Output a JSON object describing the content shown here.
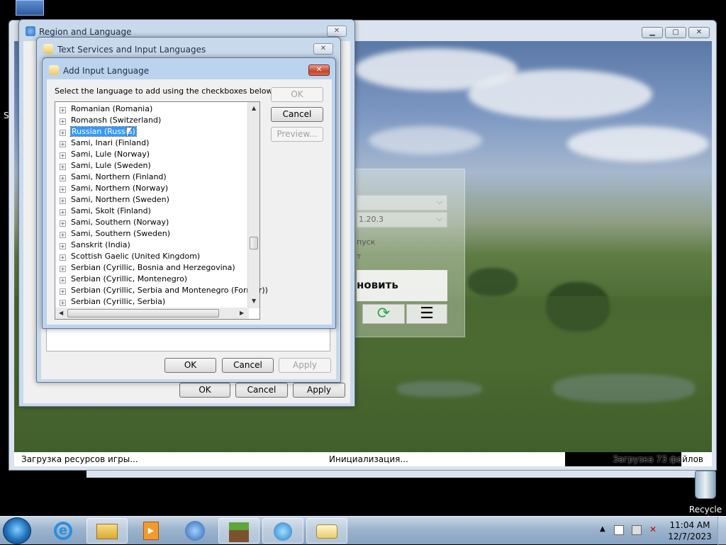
{
  "region_dialog": {
    "title": "Region and Language",
    "buttons": {
      "ok": "OK",
      "cancel": "Cancel",
      "apply": "Apply"
    }
  },
  "text_services_dialog": {
    "title": "Text Services and Input Languages",
    "buttons": {
      "ok": "OK",
      "cancel": "Cancel",
      "apply": "Apply"
    }
  },
  "add_input_dialog": {
    "title": "Add Input Language",
    "instruction": "Select the language to add using the checkboxes below.",
    "buttons": {
      "ok": "OK",
      "cancel": "Cancel",
      "preview": "Preview..."
    },
    "languages": [
      "Romanian (Romania)",
      "Romansh (Switzerland)",
      "Russian (Russia)",
      "Sami, Inari (Finland)",
      "Sami, Lule (Norway)",
      "Sami, Lule (Sweden)",
      "Sami, Northern (Finland)",
      "Sami, Northern (Norway)",
      "Sami, Northern (Sweden)",
      "Sami, Skolt (Finland)",
      "Sami, Southern (Norway)",
      "Sami, Southern (Sweden)",
      "Sanskrit (India)",
      "Scottish Gaelic (United Kingdom)",
      "Serbian (Cyrillic, Bosnia and Herzegovina)",
      "Serbian (Cyrillic, Montenegro)",
      "Serbian (Cyrillic, Serbia and Montenegro (Former))",
      "Serbian (Cyrillic, Serbia)"
    ],
    "selected_index": 2
  },
  "launcher": {
    "version_partial": "1.20.3",
    "option_partial": "пуск",
    "option2_partial": "т",
    "play_partial": "новить"
  },
  "game_status": {
    "left": "Загрузка ресурсов игры...",
    "center": "Инициализация...",
    "right": "Загрузка 73 файлов"
  },
  "desktop": {
    "recycle_bin": "Recycle Bi",
    "side_letter": "S"
  },
  "taskbar": {
    "time": "11:04 AM",
    "date": "12/7/2023"
  }
}
